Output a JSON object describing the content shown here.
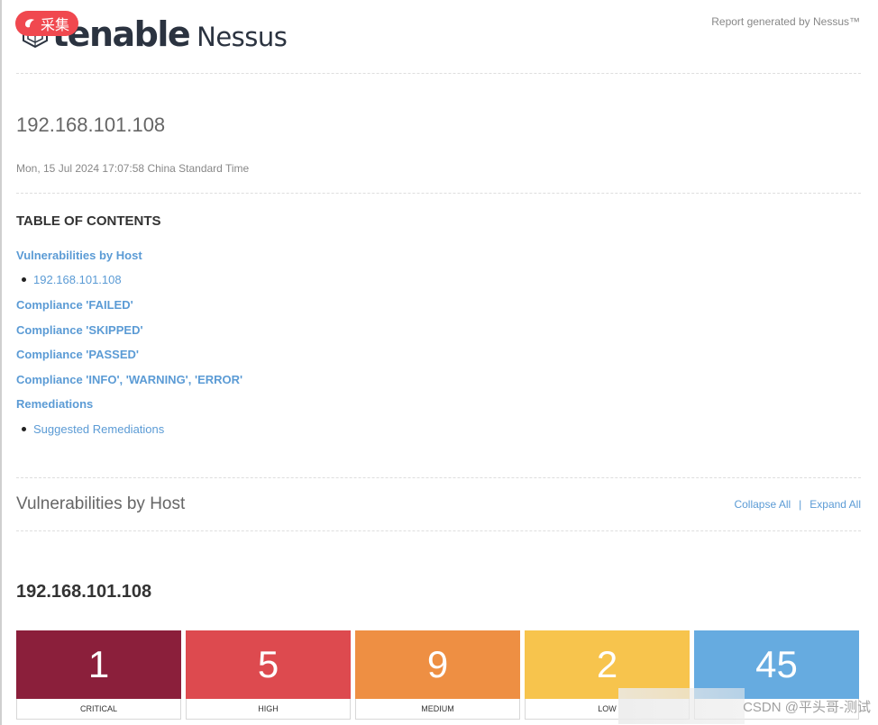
{
  "header": {
    "logo_brand": "tenable",
    "logo_product": "Nessus",
    "badge_label": "采集",
    "report_generated": "Report generated by Nessus™"
  },
  "report": {
    "host_ip": "192.168.101.108",
    "timestamp": "Mon, 15 Jul 2024 17:07:58 China Standard Time"
  },
  "toc": {
    "heading": "TABLE OF CONTENTS",
    "items": [
      {
        "label": "Vulnerabilities by Host"
      },
      {
        "label": "192.168.101.108"
      },
      {
        "label": "Compliance 'FAILED'"
      },
      {
        "label": "Compliance 'SKIPPED'"
      },
      {
        "label": "Compliance 'PASSED'"
      },
      {
        "label": "Compliance 'INFO', 'WARNING', 'ERROR'"
      },
      {
        "label": "Remediations"
      },
      {
        "label": "Suggested Remediations"
      }
    ]
  },
  "section": {
    "title": "Vulnerabilities by Host",
    "collapse_all": "Collapse All",
    "separator": "|",
    "expand_all": "Expand All"
  },
  "host": {
    "heading": "192.168.101.108",
    "severities": [
      {
        "label": "CRITICAL",
        "count": "1",
        "color": "#8b1f3b"
      },
      {
        "label": "HIGH",
        "count": "5",
        "color": "#dd4a4f"
      },
      {
        "label": "MEDIUM",
        "count": "9",
        "color": "#ee8f43"
      },
      {
        "label": "LOW",
        "count": "2",
        "color": "#f7c44d"
      },
      {
        "label": "",
        "count": "45",
        "color": "#66abe0"
      }
    ]
  },
  "watermark": {
    "text": "CSDN @平头哥-测试"
  }
}
